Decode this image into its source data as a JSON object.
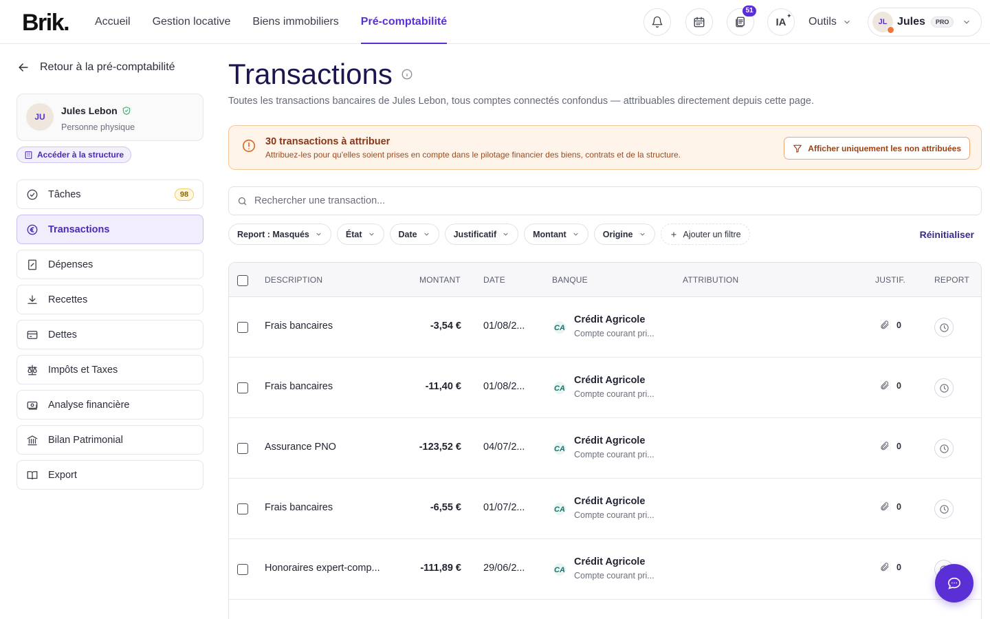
{
  "brand": {
    "logo": "Brik."
  },
  "nav": {
    "items": [
      {
        "label": "Accueil"
      },
      {
        "label": "Gestion locative"
      },
      {
        "label": "Biens immobiliers"
      },
      {
        "label": "Pré-comptabilité"
      }
    ],
    "active_index": 3
  },
  "header": {
    "notifications_icon": "bell-icon",
    "calendar_icon": "calendar-icon",
    "documents_icon": "documents-icon",
    "documents_badge": "51",
    "ia_label": "IA",
    "tools_label": "Outils",
    "user": {
      "initials": "JL",
      "name": "Jules",
      "plan": "PRO"
    }
  },
  "sidebar": {
    "back_label": "Retour à la pré-comptabilité",
    "profile": {
      "initials": "JU",
      "name": "Jules Lebon",
      "type": "Personne physique"
    },
    "structure_link": "Accéder à la structure",
    "items": [
      {
        "label": "Tâches",
        "icon": "check-circle-icon",
        "count": "98"
      },
      {
        "label": "Transactions",
        "icon": "euro-icon"
      },
      {
        "label": "Dépenses",
        "icon": "receipt-icon"
      },
      {
        "label": "Recettes",
        "icon": "download-icon"
      },
      {
        "label": "Dettes",
        "icon": "credit-card-icon"
      },
      {
        "label": "Impôts et Taxes",
        "icon": "scale-icon"
      },
      {
        "label": "Analyse financière",
        "icon": "banknote-icon"
      },
      {
        "label": "Bilan Patrimonial",
        "icon": "bank-icon"
      },
      {
        "label": "Export",
        "icon": "book-icon"
      }
    ]
  },
  "main": {
    "title": "Transactions",
    "subtitle": "Toutes les transactions bancaires de Jules Lebon, tous comptes connectés confondus — attribuables directement depuis cette page.",
    "alert": {
      "title": "30 transactions à attribuer",
      "description": "Attribuez-les pour qu'elles soient prises en compte dans le pilotage financier des biens, contrats et de la structure.",
      "button": "Afficher uniquement les non attribuées"
    },
    "search": {
      "placeholder": "Rechercher une transaction..."
    },
    "filters": [
      {
        "label": "Report : Masqués"
      },
      {
        "label": "État"
      },
      {
        "label": "Date"
      },
      {
        "label": "Justificatif"
      },
      {
        "label": "Montant"
      },
      {
        "label": "Origine"
      }
    ],
    "add_filter": "Ajouter un filtre",
    "reset": "Réinitialiser"
  },
  "table": {
    "headers": {
      "description": "DESCRIPTION",
      "amount": "MONTANT",
      "date": "DATE",
      "bank": "BANQUE",
      "attribution": "ATTRIBUTION",
      "justif": "JUSTIF.",
      "report": "REPORT"
    },
    "rows": [
      {
        "description": "Frais bancaires",
        "amount": "-3,54 €",
        "date": "01/08/2...",
        "bank": "Crédit Agricole",
        "account": "Compte courant pri...",
        "justif": "0"
      },
      {
        "description": "Frais bancaires",
        "amount": "-11,40 €",
        "date": "01/08/2...",
        "bank": "Crédit Agricole",
        "account": "Compte courant pri...",
        "justif": "0"
      },
      {
        "description": "Assurance PNO",
        "amount": "-123,52 €",
        "date": "04/07/2...",
        "bank": "Crédit Agricole",
        "account": "Compte courant pri...",
        "justif": "0"
      },
      {
        "description": "Frais bancaires",
        "amount": "-6,55 €",
        "date": "01/07/2...",
        "bank": "Crédit Agricole",
        "account": "Compte courant pri...",
        "justif": "0"
      },
      {
        "description": "Honoraires expert-comp...",
        "amount": "-111,89 €",
        "date": "29/06/2...",
        "bank": "Crédit Agricole",
        "account": "Compte courant pri...",
        "justif": "0"
      }
    ]
  },
  "colors": {
    "accent": "#5b2fd6",
    "title": "#1b1650",
    "alert_bg": "#fff4ea",
    "alert_border": "#f3c79a",
    "bank_green": "#0a7a6a"
  }
}
